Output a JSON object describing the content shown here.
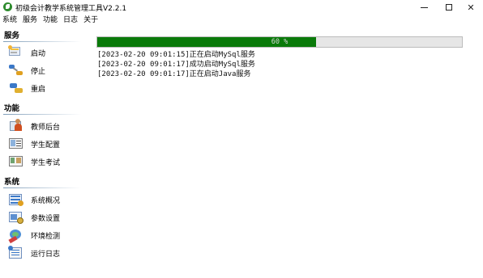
{
  "window": {
    "title": "初级会计教学系统管理工具V2.2.1",
    "brand_color": "#2e8b2e"
  },
  "menu": [
    "系统",
    "服务",
    "功能",
    "日志",
    "关于"
  ],
  "sidebar": {
    "sections": [
      {
        "title": "服务",
        "items": [
          {
            "label": "启动",
            "icon": "start-icon"
          },
          {
            "label": "停止",
            "icon": "stop-icon"
          },
          {
            "label": "重启",
            "icon": "restart-icon"
          }
        ]
      },
      {
        "title": "功能",
        "items": [
          {
            "label": "教师后台",
            "icon": "teacher-icon"
          },
          {
            "label": "学生配置",
            "icon": "student-config-icon"
          },
          {
            "label": "学生考试",
            "icon": "student-exam-icon"
          }
        ]
      },
      {
        "title": "系统",
        "items": [
          {
            "label": "系统概况",
            "icon": "overview-icon"
          },
          {
            "label": "参数设置",
            "icon": "settings-icon"
          },
          {
            "label": "环境检测",
            "icon": "environment-icon"
          },
          {
            "label": "运行日志",
            "icon": "log-icon"
          }
        ]
      }
    ]
  },
  "progress": {
    "percent": 60,
    "text": "60 %",
    "fill_color": "#0a7a0a"
  },
  "log": [
    "[2023-02-20 09:01:15]正在启动MySql服务",
    "[2023-02-20 09:01:17]成功启动MySql服务",
    "[2023-02-20 09:01:17]正在启动Java服务"
  ]
}
